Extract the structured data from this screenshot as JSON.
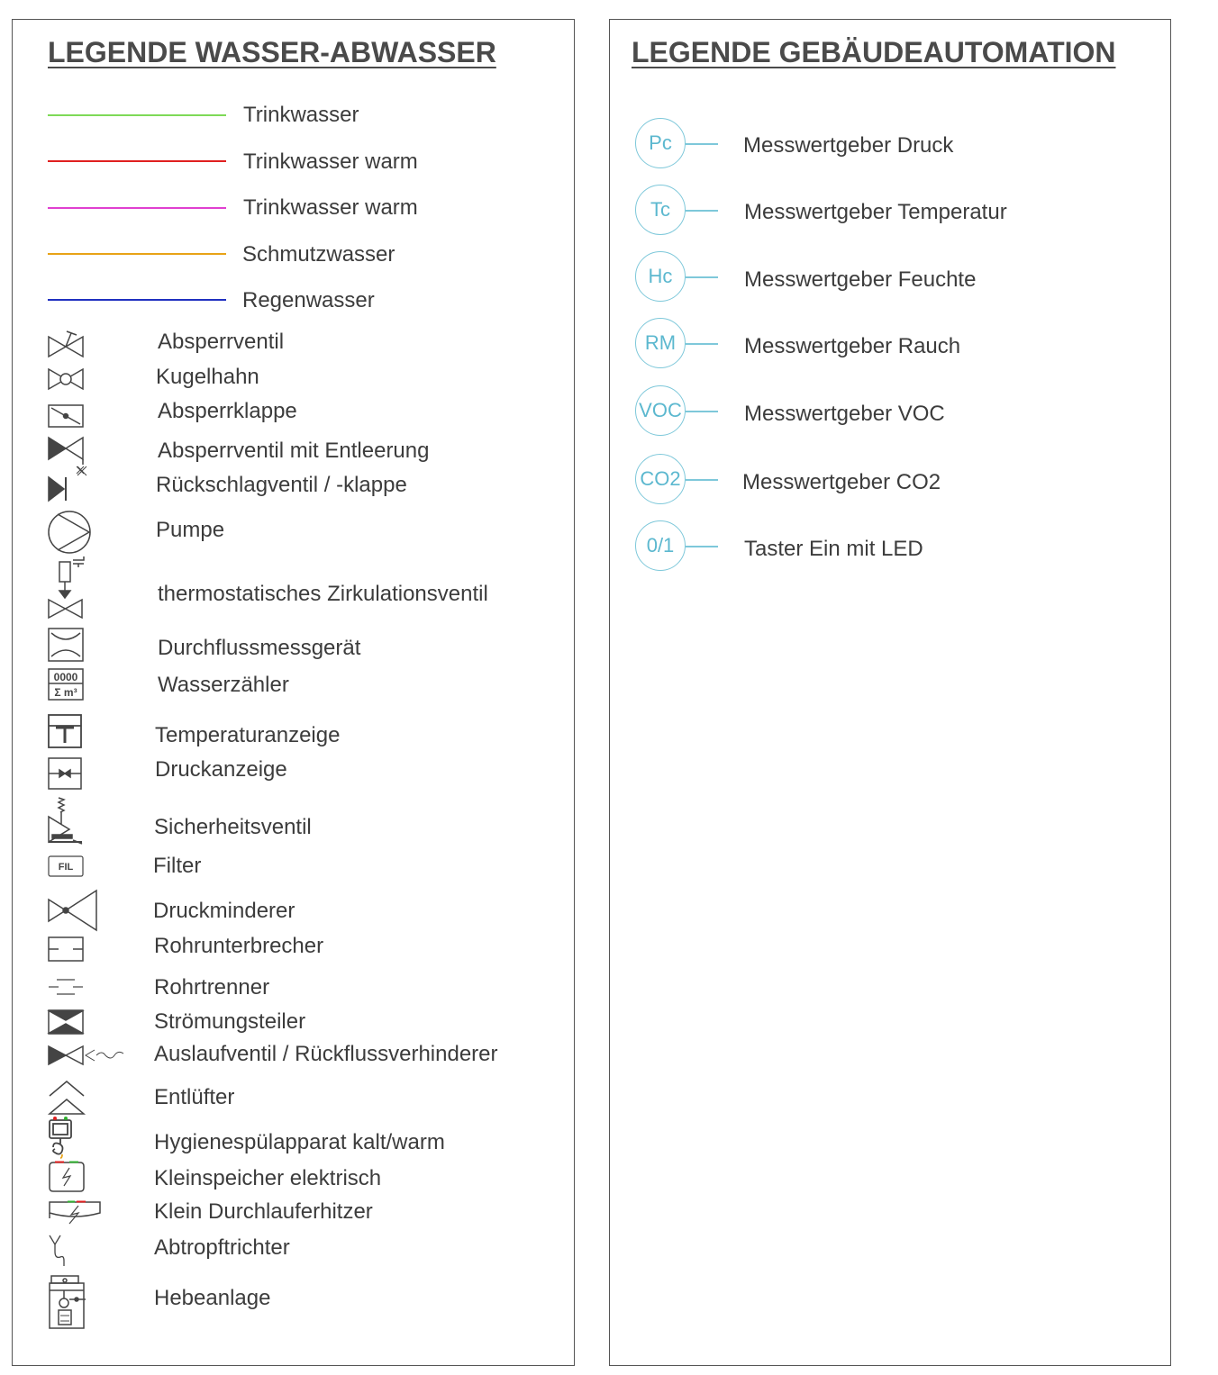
{
  "left_panel": {
    "title": "LEGENDE WASSER-ABWASSER",
    "lines": [
      {
        "label": "Trinkwasser",
        "color": "#7ed957"
      },
      {
        "label": "Trinkwasser warm",
        "color": "#e02020"
      },
      {
        "label": "Trinkwasser warm",
        "color": "#e040d0"
      },
      {
        "label": "Schmutzwasser",
        "color": "#e8a317"
      },
      {
        "label": "Regenwasser",
        "color": "#2030c0"
      }
    ],
    "symbols": [
      {
        "label": "Absperrventil",
        "icon": "shutoff-valve-icon"
      },
      {
        "label": "Kugelhahn",
        "icon": "ball-valve-icon"
      },
      {
        "label": "Absperrklappe",
        "icon": "butterfly-valve-icon"
      },
      {
        "label": "Absperrventil mit Entleerung",
        "icon": "drain-valve-icon"
      },
      {
        "label": "Rückschlagventil / -klappe",
        "icon": "check-valve-icon"
      },
      {
        "label": "Pumpe",
        "icon": "pump-icon"
      },
      {
        "label": "thermostatisches Zirkulationsventil",
        "icon": "thermostatic-valve-icon"
      },
      {
        "label": "Durchflussmessgerät",
        "icon": "flow-meter-icon"
      },
      {
        "label": "Wasserzähler",
        "icon": "water-meter-icon",
        "icon_text_top": "0000",
        "icon_text_bottom": "Σ m³"
      },
      {
        "label": "Temperaturanzeige",
        "icon": "temperature-gauge-icon"
      },
      {
        "label": "Druckanzeige",
        "icon": "pressure-gauge-icon"
      },
      {
        "label": "Sicherheitsventil",
        "icon": "safety-valve-icon"
      },
      {
        "label": "Filter",
        "icon": "filter-icon",
        "icon_text": "FIL"
      },
      {
        "label": "Druckminderer",
        "icon": "pressure-reducer-icon"
      },
      {
        "label": "Rohrunterbrecher",
        "icon": "pipe-interrupter-icon"
      },
      {
        "label": "Rohrtrenner",
        "icon": "pipe-separator-icon"
      },
      {
        "label": "Strömungsteiler",
        "icon": "flow-divider-icon"
      },
      {
        "label": "Auslaufventil / Rückflussverhinderer",
        "icon": "outlet-valve-icon"
      },
      {
        "label": "Entlüfter",
        "icon": "air-vent-icon"
      },
      {
        "label": "Hygienespülapparat kalt/warm",
        "icon": "hygiene-flush-icon"
      },
      {
        "label": "Kleinspeicher elektrisch",
        "icon": "electric-storage-heater-icon"
      },
      {
        "label": "Klein Durchlauferhitzer",
        "icon": "instant-water-heater-icon"
      },
      {
        "label": "Abtropftrichter",
        "icon": "drip-funnel-icon"
      },
      {
        "label": "Hebeanlage",
        "icon": "lifting-station-icon"
      }
    ]
  },
  "right_panel": {
    "title": "LEGENDE GEBÄUDEAUTOMATION",
    "sensor_color": "#7ec8da",
    "sensors": [
      {
        "code": "Pc",
        "label": "Messwertgeber Druck"
      },
      {
        "code": "Tc",
        "label": "Messwertgeber Temperatur"
      },
      {
        "code": "Hc",
        "label": "Messwertgeber Feuchte"
      },
      {
        "code": "RM",
        "label": "Messwertgeber Rauch"
      },
      {
        "code": "VOC",
        "label": "Messwertgeber VOC"
      },
      {
        "code": "CO2",
        "label": "Messwertgeber CO2"
      },
      {
        "code": "0/1",
        "label": "Taster Ein mit LED"
      }
    ]
  }
}
